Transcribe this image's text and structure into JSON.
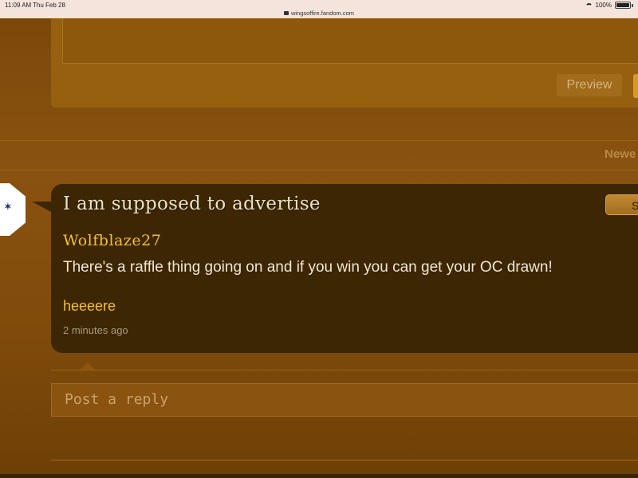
{
  "status_bar": {
    "time": "11:09 AM",
    "date": "Thu Feb 28",
    "url": "wingsoffire.fandom.com",
    "battery": "100%"
  },
  "editor": {
    "preview_label": "Preview"
  },
  "sort": {
    "label": "Newe"
  },
  "thread": {
    "title": "I am supposed to advertise",
    "action_label": "S",
    "author": "Wolfblaze27",
    "body": "There's a raffle thing going on and if you win you can get your OC drawn!",
    "link": "heeeere",
    "timestamp": "2 minutes ago"
  },
  "reply": {
    "placeholder": "Post a reply"
  },
  "colors": {
    "background": "#7a4708",
    "card": "#3d2603",
    "accent": "#f2c12e",
    "title_text": "#e9e1c7"
  }
}
